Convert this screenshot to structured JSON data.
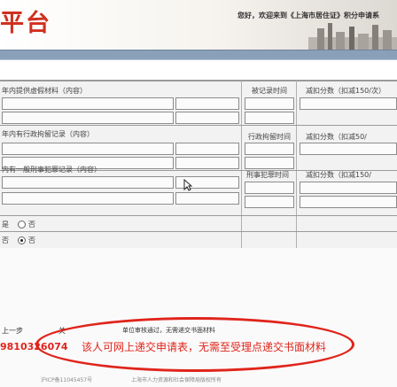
{
  "header": {
    "logo_text": "平台",
    "welcome_text": "您好，欢迎来到《上海市居住证》积分申请系",
    "brand_color": "#d0301f"
  },
  "sections": [
    {
      "title": "年内提供虚假材料（内容）",
      "time_label": "被记录时间",
      "score_label": "减扣分数（扣减150/次）"
    },
    {
      "title": "年内有行政拘留记录（内容）",
      "time_label": "行政拘留时间",
      "score_label": "减扣分数（扣减50/"
    },
    {
      "title": "内有一般刑事犯罪记录（内容）",
      "time_label": "刑事犯罪时间",
      "score_label": "减扣分数（扣减150/"
    }
  ],
  "options": [
    {
      "label": "是",
      "radio_text": "否",
      "selected": false
    },
    {
      "label": "否",
      "radio_text": "否",
      "selected": true
    }
  ],
  "actions": {
    "prev_label": "上一步",
    "close_label": "关",
    "review_status": "单位审核通过，无需递交书面材料"
  },
  "annotation": {
    "id_fragment": "9810326074",
    "notice": "该人可网上递交申请表，无需至受理点递交书面材料",
    "color": "#e0241b"
  },
  "footer": {
    "icp": "沪ICP备11045457号",
    "owner": "上海市人力资源和社会保障局版权所有"
  }
}
